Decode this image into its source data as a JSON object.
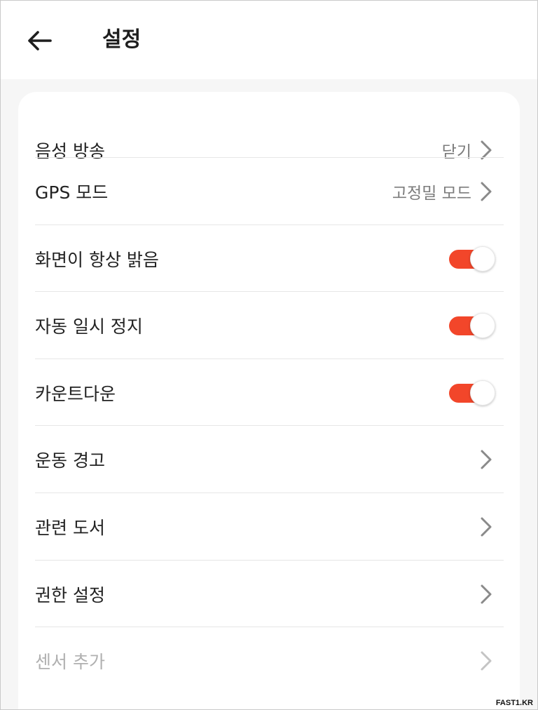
{
  "header": {
    "title": "설정",
    "back_icon": "arrow-left-icon"
  },
  "settings": [
    {
      "label": "음성 방송",
      "value": "닫기",
      "control": "chevron"
    },
    {
      "label": "GPS 모드",
      "value": "고정밀 모드",
      "control": "chevron"
    },
    {
      "label": "화면이 항상 밝음",
      "control": "toggle",
      "on": true
    },
    {
      "label": "자동 일시 정지",
      "control": "toggle",
      "on": true
    },
    {
      "label": "카운트다운",
      "control": "toggle",
      "on": true
    },
    {
      "label": "운동 경고",
      "control": "chevron"
    },
    {
      "label": "관련 도서",
      "control": "chevron"
    },
    {
      "label": "권한 설정",
      "control": "chevron"
    },
    {
      "label": "센서 추가",
      "control": "chevron",
      "disabled": true
    }
  ],
  "colors": {
    "accent": "#f2462a",
    "background": "#f6f6f6",
    "card": "#ffffff"
  },
  "watermark": "FAST1.KR"
}
